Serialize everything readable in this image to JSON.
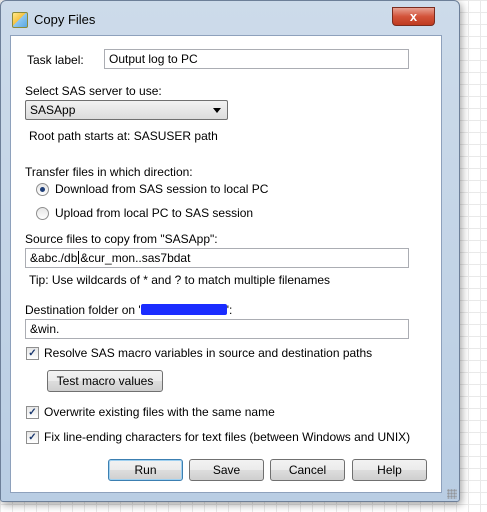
{
  "window": {
    "title": "Copy Files",
    "close_glyph": "x",
    "icon": "copy-files-app-icon"
  },
  "task": {
    "label": "Task label:",
    "value": "Output log to PC"
  },
  "server": {
    "label": "Select SAS server to use:",
    "selected": "SASApp",
    "root_path": "Root path starts at: SASUSER path"
  },
  "direction": {
    "label": "Transfer files in which direction:",
    "options": [
      {
        "label": "Download from SAS session to local PC",
        "selected": true
      },
      {
        "label": "Upload from local PC to SAS session",
        "selected": false
      }
    ]
  },
  "source": {
    "label": "Source files to copy from \"SASApp\":",
    "value_before_caret": "&abc./db",
    "value_after_caret": "&cur_mon..sas7bdat",
    "tip": "Tip: Use wildcards of * and ? to match multiple filenames"
  },
  "destination": {
    "label_prefix": "Destination folder on '",
    "label_suffix": "':",
    "value": "&win."
  },
  "options": {
    "resolve_macros": {
      "label": "Resolve SAS macro variables in source and destination paths",
      "checked": true
    },
    "test_macro_button": "Test macro values",
    "overwrite": {
      "label": "Overwrite existing files with the same name",
      "checked": true
    },
    "fix_line_endings": {
      "label": "Fix line-ending characters for text files (between Windows and UNIX)",
      "checked": true
    }
  },
  "buttons": {
    "run": "Run",
    "save": "Save",
    "cancel": "Cancel",
    "help": "Help"
  },
  "colors": {
    "frame": "#c4d5e8",
    "close_button": "#c9482e",
    "redaction": "#1a2cff"
  }
}
